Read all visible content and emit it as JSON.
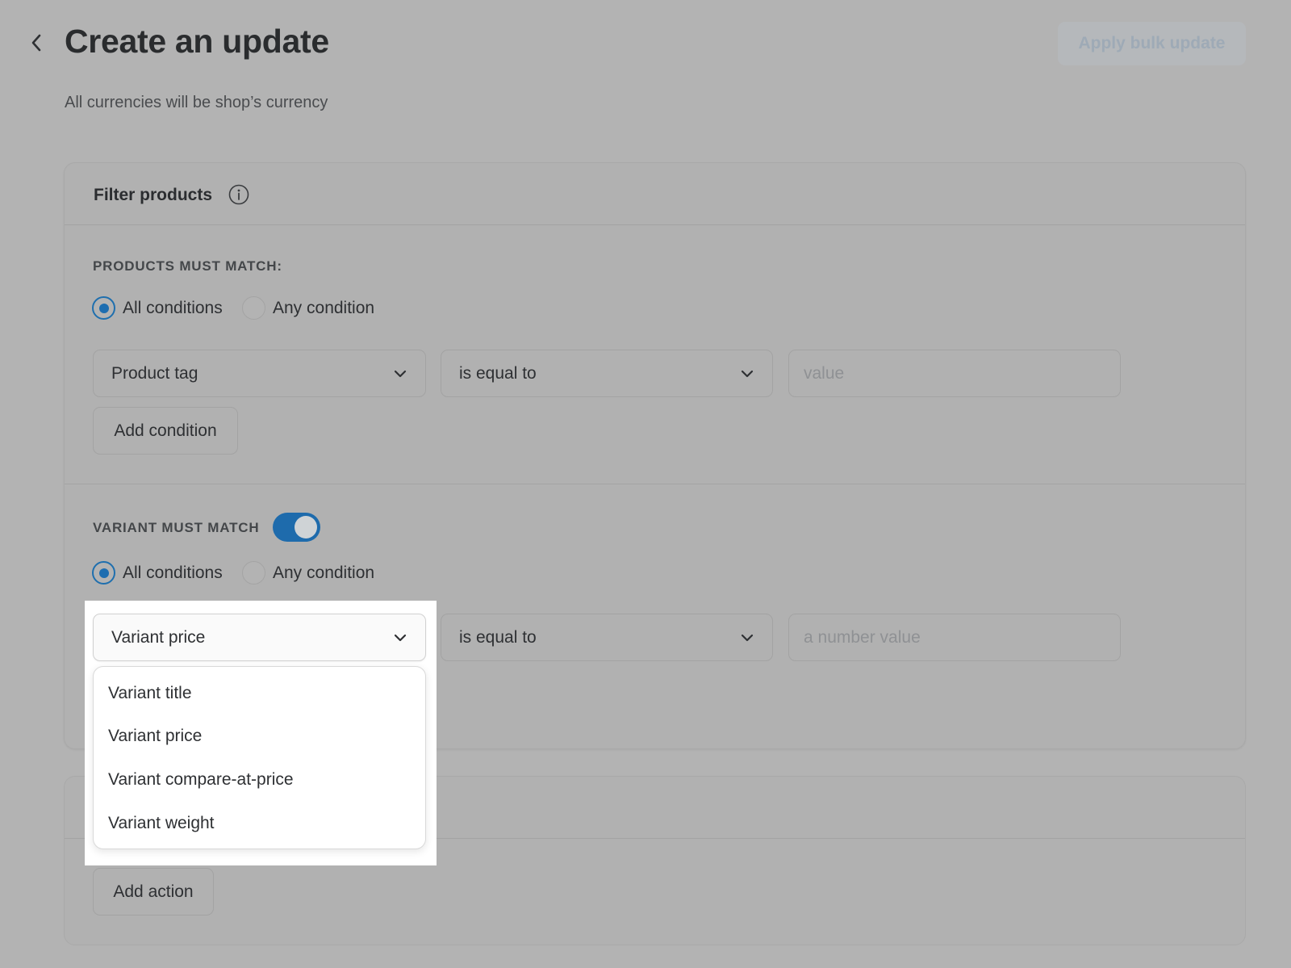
{
  "header": {
    "title": "Create an update",
    "subtitle": "All currencies will be shop’s currency",
    "apply_label": "Apply bulk update"
  },
  "filter_card": {
    "title": "Filter products",
    "products": {
      "label": "PRODUCTS MUST MATCH:",
      "radio_all": "All conditions",
      "radio_any": "Any condition",
      "field_value": "Product tag",
      "operator_value": "is equal to",
      "value_placeholder": "value",
      "add_condition_label": "Add condition"
    },
    "variant": {
      "label": "VARIANT MUST MATCH",
      "toggle_on": true,
      "radio_all": "All conditions",
      "radio_any": "Any condition",
      "field_value": "Variant price",
      "operator_value": "is equal to",
      "value_placeholder": "a number value",
      "dropdown_options": [
        "Variant title",
        "Variant price",
        "Variant compare-at-price",
        "Variant weight"
      ]
    }
  },
  "actions_card": {
    "add_action_label": "Add action"
  },
  "colors": {
    "accent": "#1d6db0",
    "overlay_bg": "#b3b3b3",
    "highlight_bg": "#ffffff"
  },
  "icons": {
    "back": "chevron-left-icon",
    "info": "info-icon",
    "dropdown": "chevron-down-icon"
  }
}
